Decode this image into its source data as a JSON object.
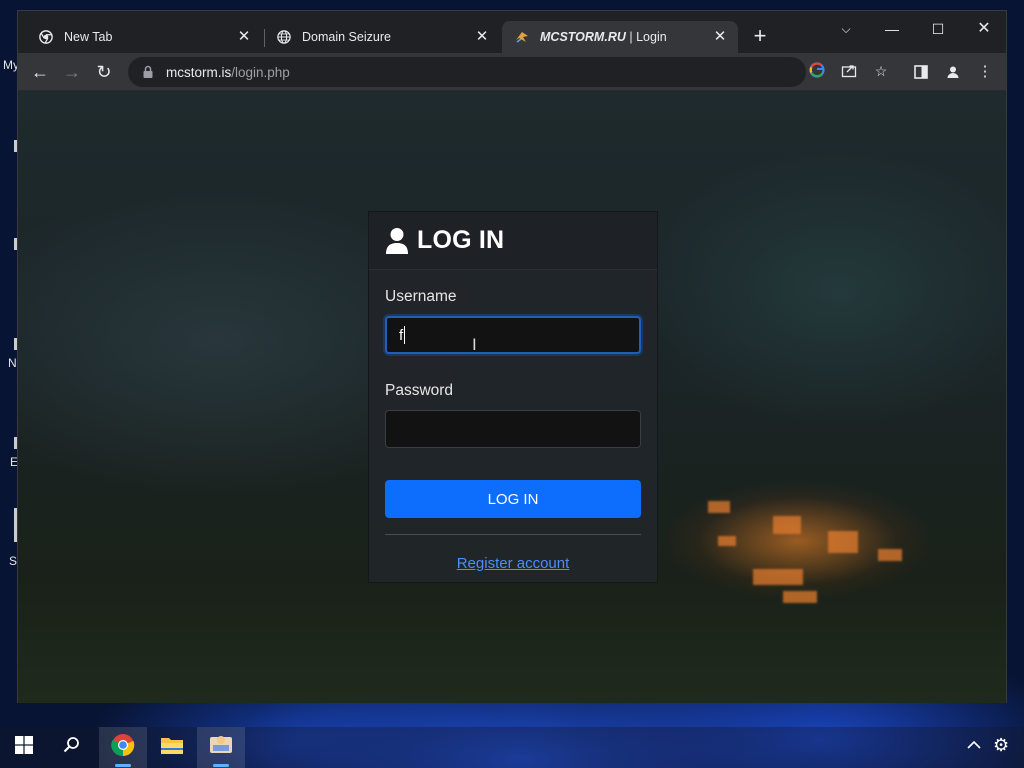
{
  "desktop": {
    "icon_labels": [
      "My",
      "N",
      "E",
      "Si"
    ]
  },
  "browser": {
    "tabs": [
      {
        "title": "New Tab",
        "favicon": "chrome-icon",
        "active": false
      },
      {
        "title": "Domain Seizure",
        "favicon": "globe-icon",
        "active": false
      },
      {
        "title_bold": "MCSTORM.RU",
        "title_rest": " | Login",
        "favicon": "mcstorm-logo-icon",
        "active": true
      }
    ],
    "address": {
      "host": "mcstorm.is",
      "path": "/login.php"
    }
  },
  "login": {
    "heading": "LOG IN",
    "username_label": "Username",
    "username_value": "f",
    "password_label": "Password",
    "password_value": "",
    "submit_label": "LOG IN",
    "register_link": "Register account",
    "accent_color": "#0d6efd"
  },
  "taskbar": {
    "items": [
      "start-icon",
      "search-icon",
      "chrome-icon",
      "file-explorer-icon",
      "app-icon"
    ]
  }
}
